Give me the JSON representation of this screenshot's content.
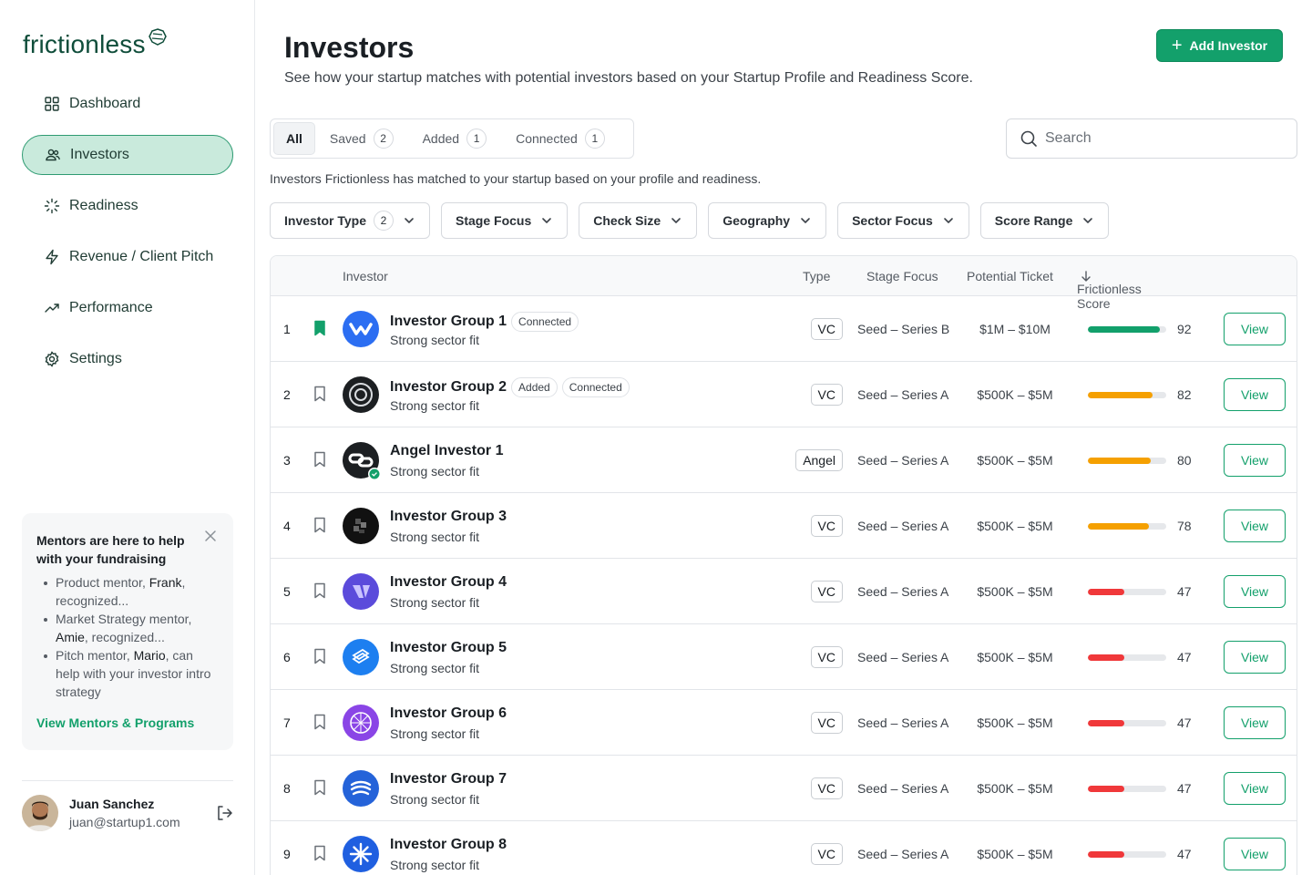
{
  "brand": {
    "name": "frictionless",
    "accent": "#13a06b"
  },
  "sidebar": {
    "items": [
      {
        "label": "Dashboard",
        "icon": "grid-icon"
      },
      {
        "label": "Investors",
        "icon": "users-icon",
        "active": true
      },
      {
        "label": "Readiness",
        "icon": "loader-icon"
      },
      {
        "label": "Revenue / Client Pitch",
        "icon": "lightning-icon"
      },
      {
        "label": "Performance",
        "icon": "trend-up-icon"
      },
      {
        "label": "Settings",
        "icon": "gear-icon"
      }
    ],
    "mentor_card": {
      "title": "Mentors are here to help with your fundraising",
      "items": [
        {
          "pre": "Product mentor, ",
          "name": "Frank",
          "post": ", recognized..."
        },
        {
          "pre": "Market Strategy mentor, ",
          "name": "Amie",
          "post": ", recognized..."
        },
        {
          "pre": "Pitch mentor, ",
          "name": "Mario",
          "post": ", can help with your investor intro strategy"
        }
      ],
      "link": "View Mentors & Programs"
    },
    "user": {
      "name": "Juan Sanchez",
      "email": "juan@startup1.com"
    }
  },
  "header": {
    "title": "Investors",
    "subtitle": "See how your startup matches with potential investors based on your Startup Profile and Readiness Score.",
    "add_button": "Add Investor"
  },
  "tabs": [
    {
      "label": "All",
      "active": true
    },
    {
      "label": "Saved",
      "count": "2"
    },
    {
      "label": "Added",
      "count": "1"
    },
    {
      "label": "Connected",
      "count": "1"
    }
  ],
  "search": {
    "placeholder": "Search"
  },
  "caption": "Investors Frictionless has matched to your startup based on your profile and readiness.",
  "filters": [
    {
      "label": "Investor Type",
      "count": "2"
    },
    {
      "label": "Stage Focus"
    },
    {
      "label": "Check Size"
    },
    {
      "label": "Geography"
    },
    {
      "label": "Sector Focus"
    },
    {
      "label": "Score Range"
    }
  ],
  "table": {
    "columns": {
      "investor": "Investor",
      "type": "Type",
      "stage": "Stage Focus",
      "ticket": "Potential Ticket",
      "score": "Frictionless Score"
    },
    "view_label": "View",
    "rows": [
      {
        "rank": "1",
        "saved": true,
        "name": "Investor Group 1",
        "badges": [
          "Connected"
        ],
        "fit": "Strong sector fit",
        "type": "VC",
        "stage": "Seed – Series B",
        "ticket": "$1M – $10M",
        "score": 92,
        "score_color": "#12a06b",
        "logo": "blue-w-logo"
      },
      {
        "rank": "2",
        "saved": false,
        "name": "Investor Group 2",
        "badges": [
          "Added",
          "Connected"
        ],
        "fit": "Strong sector fit",
        "type": "VC",
        "stage": "Seed – Series A",
        "ticket": "$500K – $5M",
        "score": 82,
        "score_color": "#f5a000",
        "logo": "dark-ring-logo"
      },
      {
        "rank": "3",
        "saved": false,
        "name": "Angel Investor 1",
        "badges": [],
        "fit": "Strong sector fit",
        "type": "Angel",
        "stage": "Seed – Series A",
        "ticket": "$500K – $5M",
        "score": 80,
        "score_color": "#f5a000",
        "logo": "dark-link-logo",
        "verified": true
      },
      {
        "rank": "4",
        "saved": false,
        "name": "Investor Group 3",
        "badges": [],
        "fit": "Strong sector fit",
        "type": "VC",
        "stage": "Seed – Series A",
        "ticket": "$500K – $5M",
        "score": 78,
        "score_color": "#f5a000",
        "logo": "dark-pixel-logo"
      },
      {
        "rank": "5",
        "saved": false,
        "name": "Investor Group 4",
        "badges": [],
        "fit": "Strong sector fit",
        "type": "VC",
        "stage": "Seed – Series A",
        "ticket": "$500K – $5M",
        "score": 47,
        "score_color": "#f0383a",
        "logo": "violet-v-logo"
      },
      {
        "rank": "6",
        "saved": false,
        "name": "Investor Group 5",
        "badges": [],
        "fit": "Strong sector fit",
        "type": "VC",
        "stage": "Seed – Series A",
        "ticket": "$500K – $5M",
        "score": 47,
        "score_color": "#f0383a",
        "logo": "blue-cube-logo"
      },
      {
        "rank": "7",
        "saved": false,
        "name": "Investor Group 6",
        "badges": [],
        "fit": "Strong sector fit",
        "type": "VC",
        "stage": "Seed – Series A",
        "ticket": "$500K – $5M",
        "score": 47,
        "score_color": "#f0383a",
        "logo": "purple-orb-logo"
      },
      {
        "rank": "8",
        "saved": false,
        "name": "Investor Group 7",
        "badges": [],
        "fit": "Strong sector fit",
        "type": "VC",
        "stage": "Seed – Series A",
        "ticket": "$500K – $5M",
        "score": 47,
        "score_color": "#f0383a",
        "logo": "blue-wave-logo"
      },
      {
        "rank": "9",
        "saved": false,
        "name": "Investor Group 8",
        "badges": [],
        "fit": "Strong sector fit",
        "type": "VC",
        "stage": "Seed – Series A",
        "ticket": "$500K – $5M",
        "score": 47,
        "score_color": "#f0383a",
        "logo": "blue-star-logo"
      }
    ]
  }
}
